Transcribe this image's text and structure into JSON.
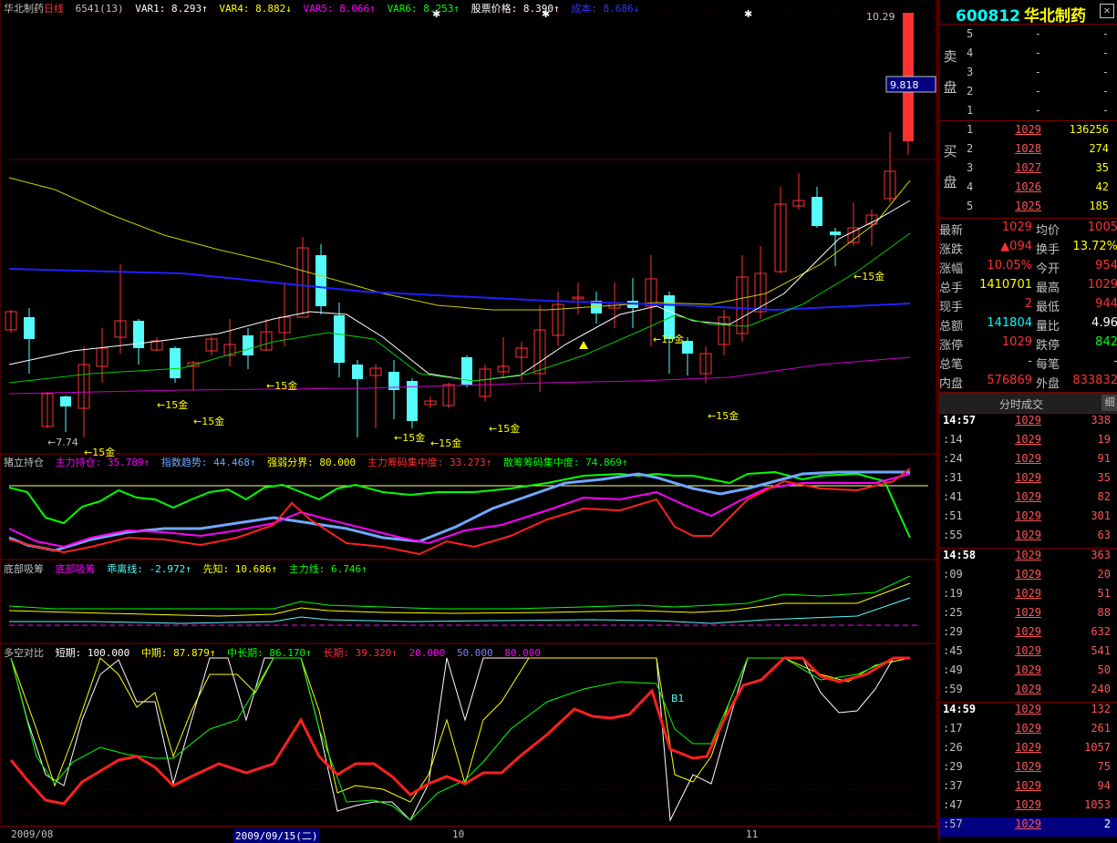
{
  "header_main": {
    "title": "华北制药",
    "period": "日线",
    "count": "6541(13)",
    "var1": "VAR1: 8.293↑",
    "var4": "VAR4: 8.882↓",
    "var5": "VAR5: 8.066↑",
    "var6": "VAR6: 8.253↑",
    "price": "股票价格: 8.390↑",
    "cost": "成本: 8.686↓"
  },
  "price_axis": {
    "high": "10.29",
    "low": "7.74",
    "current_tag": "9.818"
  },
  "annotations": {
    "gold_label": "←15金",
    "gold_label_alt": "15金",
    "marker_b1": "B1"
  },
  "panel2": {
    "name": "猪立持仓",
    "l1": "主力持仓: 35.789↑",
    "l2": "指数趋势: 44.468↑",
    "l3": "强弱分界: 80.000",
    "l4": "主力筹码集中度: 33.273↑",
    "l5": "散筹筹码集中度: 74.869↑"
  },
  "panel3": {
    "name": "底部吸筹",
    "l1": "底部吸筹",
    "l2": "乖离线: -2.972↑",
    "l3": "先知: 10.686↑",
    "l4": "主力线: 6.746↑"
  },
  "panel4": {
    "name": "多空对比",
    "l1": "短期: 100.000",
    "l2": "中期: 87.879↑",
    "l3": "中长期: 86.170↑",
    "l4": "长期: 39.320↑",
    "l5": "20.000",
    "l6": "50.000",
    "l7": "80.000"
  },
  "datebar": {
    "d1": "2009/08",
    "d2": "2009/09/15(二)",
    "d3": "10",
    "d4": "11"
  },
  "quote": {
    "code": "600812",
    "name": "华北制药",
    "sell_label": "卖盘",
    "buy_label": "买盘",
    "sell": [
      {
        "lv": "5",
        "price": "-",
        "vol": "-"
      },
      {
        "lv": "4",
        "price": "-",
        "vol": "-"
      },
      {
        "lv": "3",
        "price": "-",
        "vol": "-"
      },
      {
        "lv": "2",
        "price": "-",
        "vol": "-"
      },
      {
        "lv": "1",
        "price": "-",
        "vol": "-"
      }
    ],
    "buy": [
      {
        "lv": "1",
        "price": "1029",
        "vol": "136256"
      },
      {
        "lv": "2",
        "price": "1028",
        "vol": "274"
      },
      {
        "lv": "3",
        "price": "1027",
        "vol": "35"
      },
      {
        "lv": "4",
        "price": "1026",
        "vol": "42"
      },
      {
        "lv": "5",
        "price": "1025",
        "vol": "185"
      }
    ],
    "stats": [
      {
        "k": "最新",
        "v": "1029",
        "k2": "均价",
        "v2": "1005"
      },
      {
        "k": "涨跌",
        "v": "▲094",
        "k2": "换手",
        "v2": "13.72%"
      },
      {
        "k": "涨幅",
        "v": "10.05%",
        "k2": "今开",
        "v2": "954"
      },
      {
        "k": "总手",
        "v": "1410701",
        "k2": "最高",
        "v2": "1029"
      },
      {
        "k": "现手",
        "v": "2",
        "k2": "最低",
        "v2": "944"
      },
      {
        "k": "总额",
        "v": "141804",
        "k2": "量比",
        "v2": "4.96"
      },
      {
        "k": "涨停",
        "v": "1029",
        "k2": "跌停",
        "v2": "842"
      },
      {
        "k": "总笔",
        "v": "-",
        "k2": "每笔",
        "v2": "-"
      },
      {
        "k": "内盘",
        "v": "576869",
        "k2": "外盘",
        "v2": "833832"
      }
    ],
    "tick_title": "分时成交",
    "tick_btn": "细",
    "ticks": [
      {
        "t": "14:57",
        "p": "1029",
        "v": "338",
        "full": true
      },
      {
        "t": ":14",
        "p": "1029",
        "v": "19"
      },
      {
        "t": ":24",
        "p": "1029",
        "v": "91"
      },
      {
        "t": ":31",
        "p": "1029",
        "v": "35"
      },
      {
        "t": ":41",
        "p": "1029",
        "v": "82"
      },
      {
        "t": ":51",
        "p": "1029",
        "v": "301"
      },
      {
        "t": ":55",
        "p": "1029",
        "v": "63"
      },
      {
        "t": "14:58",
        "p": "1029",
        "v": "363",
        "full": true
      },
      {
        "t": ":09",
        "p": "1029",
        "v": "20"
      },
      {
        "t": ":19",
        "p": "1029",
        "v": "51"
      },
      {
        "t": ":25",
        "p": "1029",
        "v": "88"
      },
      {
        "t": ":29",
        "p": "1029",
        "v": "632"
      },
      {
        "t": ":45",
        "p": "1029",
        "v": "541"
      },
      {
        "t": ":49",
        "p": "1029",
        "v": "50"
      },
      {
        "t": ":59",
        "p": "1029",
        "v": "240"
      },
      {
        "t": "14:59",
        "p": "1029",
        "v": "132",
        "full": true
      },
      {
        "t": ":17",
        "p": "1029",
        "v": "261"
      },
      {
        "t": ":26",
        "p": "1029",
        "v": "1057"
      },
      {
        "t": ":29",
        "p": "1029",
        "v": "75"
      },
      {
        "t": ":37",
        "p": "1029",
        "v": "94"
      },
      {
        "t": ":47",
        "p": "1029",
        "v": "1053"
      },
      {
        "t": ":57",
        "p": "1029",
        "v": "2",
        "sel": true
      }
    ]
  },
  "colors": {
    "up": "#ff3232",
    "down": "#54fcfc",
    "frame": "#800000"
  }
}
